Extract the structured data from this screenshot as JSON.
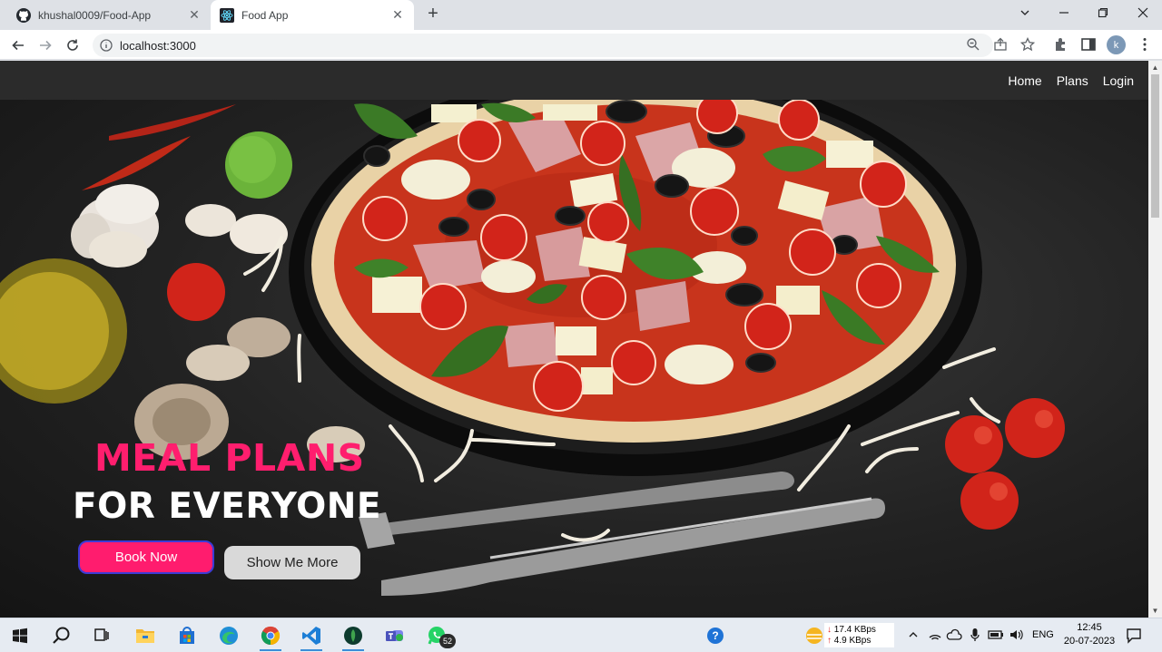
{
  "browser": {
    "tabs": [
      {
        "title": "khushal0009/Food-App",
        "icon": "github-icon",
        "active": false
      },
      {
        "title": "Food App",
        "icon": "react-icon",
        "active": true
      }
    ],
    "new_tab": "+",
    "address": "localhost:3000",
    "profile_initial": "k"
  },
  "site": {
    "nav": {
      "home": "Home",
      "plans": "Plans",
      "login": "Login"
    },
    "hero": {
      "title_line1": "MEAL PLANS",
      "title_line2": "FOR EVERYONE",
      "book_button": "Book Now",
      "more_button": "Show Me More"
    },
    "colors": {
      "accent": "#ff1c6e",
      "nav_bg": "#2b2b2b",
      "secondary_button": "#d9d9d9"
    }
  },
  "taskbar": {
    "apps": [
      "windows-start-icon",
      "search-icon",
      "task-view-icon",
      "file-explorer-icon",
      "store-icon",
      "edge-icon",
      "chrome-icon",
      "vscode-icon",
      "mongodb-compass-icon",
      "teams-icon",
      "whatsapp-icon"
    ],
    "whatsapp_badge": "52",
    "net_down": "17.4 KBps",
    "net_up": "4.9 KBps",
    "language": "ENG",
    "time": "12:45",
    "date": "20-07-2023"
  }
}
